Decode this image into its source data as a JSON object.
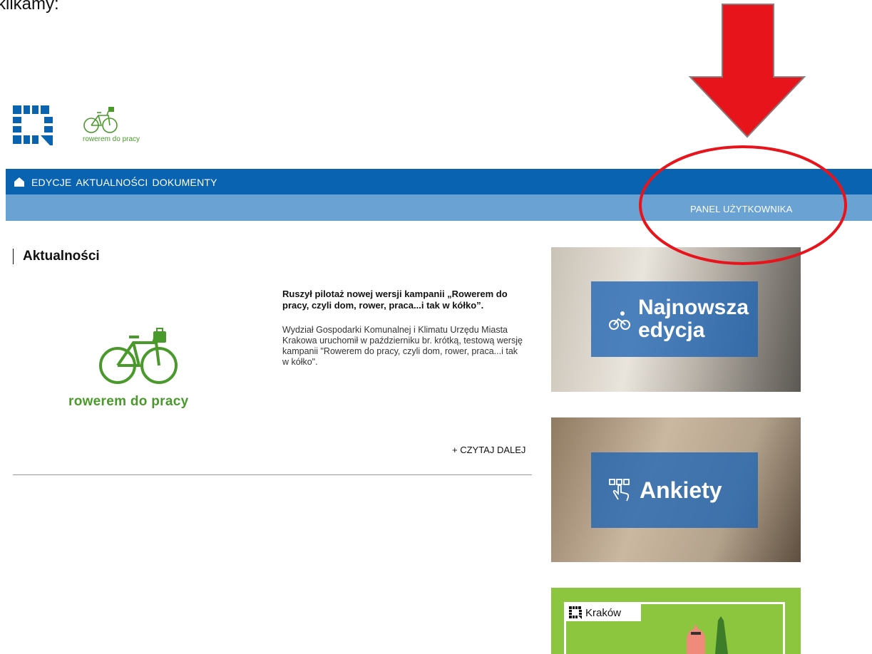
{
  "caption": "klikamy:",
  "logos": {
    "rower_text": "rowerem do pracy"
  },
  "nav": {
    "items": [
      "EDYCJE",
      "AKTUALNOŚCI",
      "DOKUMENTY"
    ],
    "panel_link": "PANEL UŻYTKOWNIKA"
  },
  "section": {
    "title": "Aktualności"
  },
  "news": {
    "image_text": "rowerem do pracy",
    "title": "Ruszył pilotaż nowej wersji kampanii „Rowerem do pracy, czyli dom, rower, praca...i tak w kółko”.",
    "text": "Wydział Gospodarki Komunalnej i Klimatu Urzędu Miasta Krakowa uruchomił w październiku br. krótką, testową wersję kampanii \"Rowerem do pracy, czyli dom, rower, praca...i tak w kółko\".",
    "read_more": "+ CZYTAJ DALEJ"
  },
  "tiles": [
    {
      "label": "Najnowsza edycja",
      "icon": "bicycle-rider-icon"
    },
    {
      "label": "Ankiety",
      "icon": "survey-touch-icon"
    },
    {
      "label": "Kraków",
      "icon": "krakow-logo-icon"
    }
  ],
  "colors": {
    "nav_primary": "#0a63b1",
    "nav_secondary": "#6aa3d3",
    "brand_green": "#4a9a2b",
    "annotation_red": "#e8141c"
  }
}
